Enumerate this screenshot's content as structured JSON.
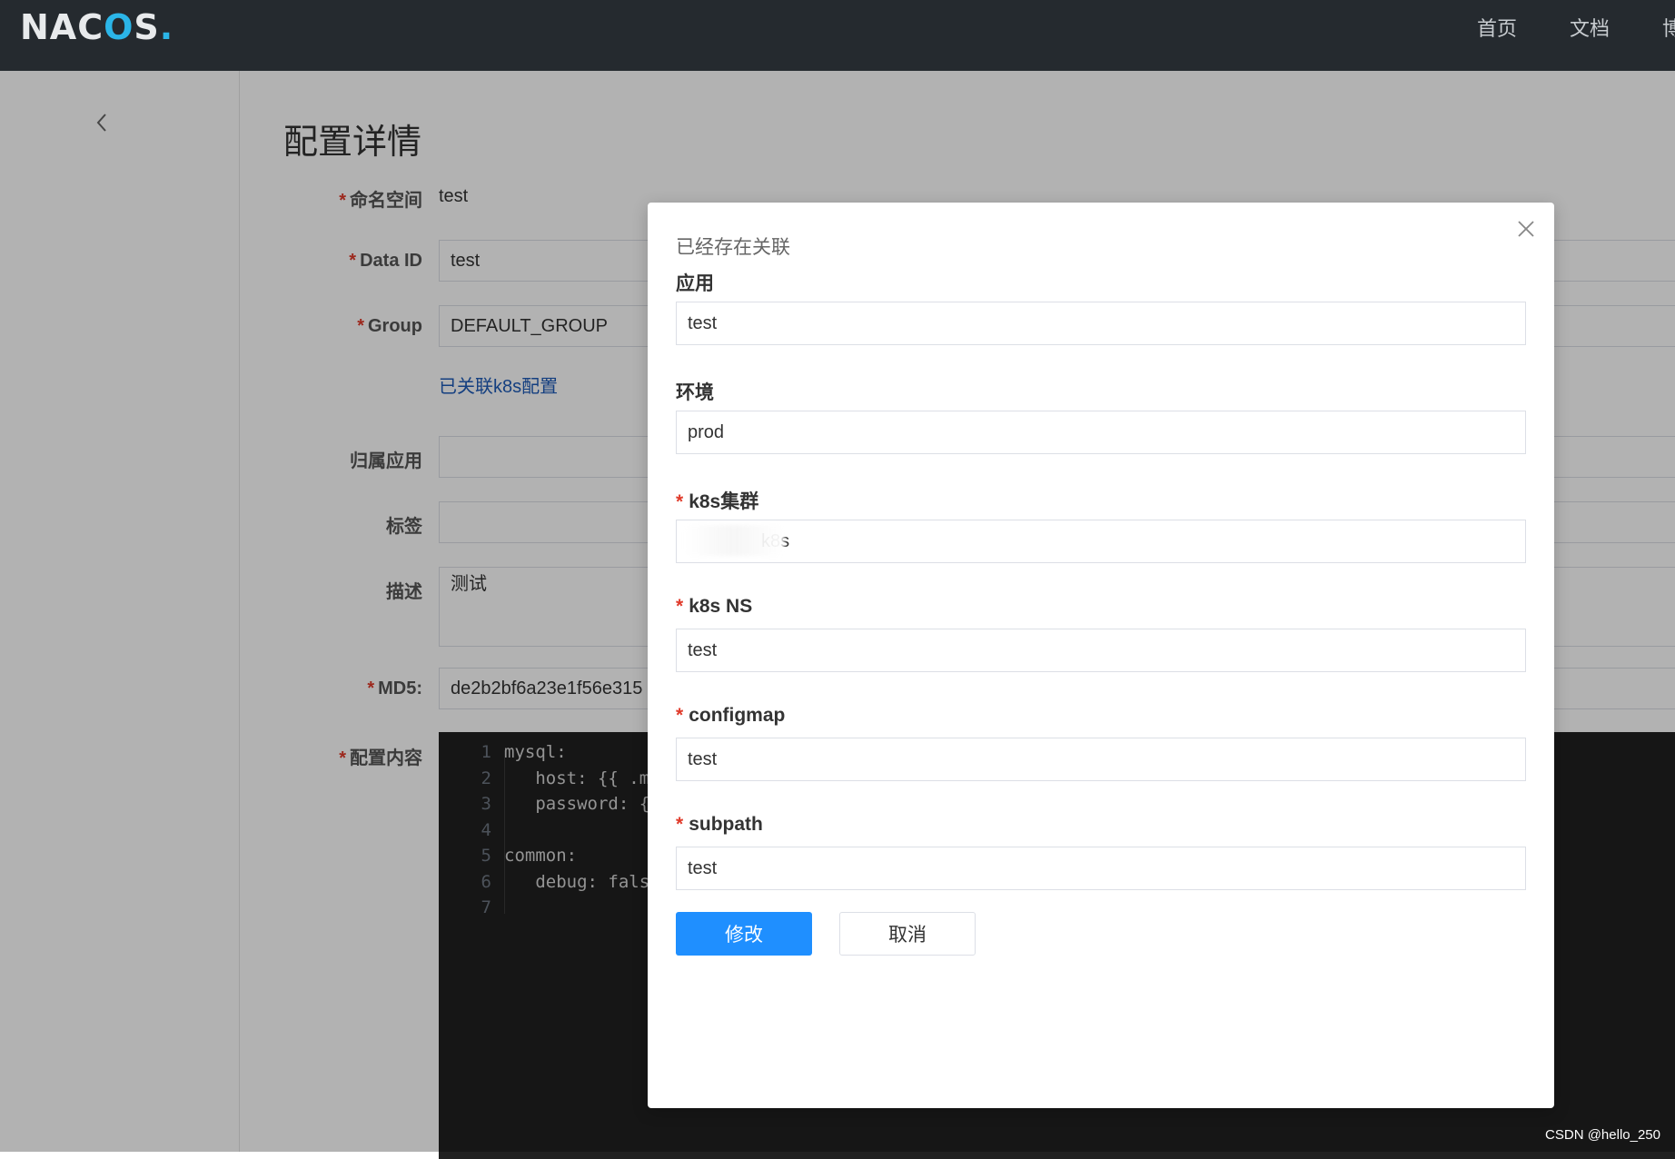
{
  "header": {
    "logo_part1": "NA",
    "logo_part2": "C",
    "logo_part3": "O",
    "logo_part4": "S",
    "logo_dot": ".",
    "nav": [
      "首页",
      "文档",
      "博"
    ]
  },
  "page": {
    "title": "配置详情",
    "fields": {
      "namespace": {
        "label": "命名空间",
        "value": "test"
      },
      "data_id": {
        "label": "Data ID",
        "value": "test"
      },
      "group": {
        "label": "Group",
        "value": "DEFAULT_GROUP"
      },
      "k8s_link": "已关联k8s配置",
      "app": {
        "label": "归属应用",
        "value": ""
      },
      "tags": {
        "label": "标签",
        "value": ""
      },
      "desc": {
        "label": "描述",
        "value": "测试"
      },
      "md5": {
        "label": "MD5:",
        "value": "de2b2bf6a23e1f56e315"
      },
      "content": {
        "label": "配置内容"
      }
    },
    "editor_lines": [
      {
        "n": "1",
        "code": "mysql:"
      },
      {
        "n": "2",
        "code": "   host: {{ .m"
      },
      {
        "n": "3",
        "code": "   password: {"
      },
      {
        "n": "4",
        "code": ""
      },
      {
        "n": "5",
        "code": "common:"
      },
      {
        "n": "6",
        "code": "   debug: fals"
      },
      {
        "n": "7",
        "code": ""
      }
    ]
  },
  "modal": {
    "title": "已经存在关联",
    "fields": [
      {
        "label": "应用",
        "required": false,
        "value": "test"
      },
      {
        "label": "环境",
        "required": false,
        "value": "prod"
      },
      {
        "label": "k8s集群",
        "required": true,
        "value": "k8s"
      },
      {
        "label": "k8s NS",
        "required": true,
        "value": "test"
      },
      {
        "label": "configmap",
        "required": true,
        "value": "test"
      },
      {
        "label": "subpath",
        "required": true,
        "value": "test"
      }
    ],
    "submit_label": "修改",
    "cancel_label": "取消"
  },
  "watermark": "CSDN @hello_250"
}
